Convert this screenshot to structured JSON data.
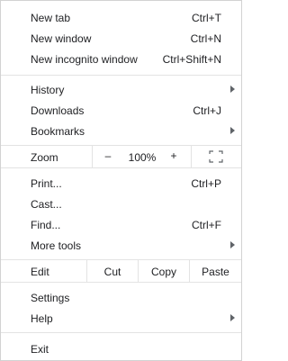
{
  "menu": {
    "items_top": [
      {
        "label": "New tab",
        "shortcut": "Ctrl+T"
      },
      {
        "label": "New window",
        "shortcut": "Ctrl+N"
      },
      {
        "label": "New incognito window",
        "shortcut": "Ctrl+Shift+N"
      }
    ],
    "history": {
      "label": "History"
    },
    "downloads": {
      "label": "Downloads",
      "shortcut": "Ctrl+J"
    },
    "bookmarks": {
      "label": "Bookmarks"
    },
    "zoom": {
      "label": "Zoom",
      "minus": "–",
      "value": "100%",
      "plus": "+"
    },
    "print": {
      "label": "Print...",
      "shortcut": "Ctrl+P"
    },
    "cast": {
      "label": "Cast..."
    },
    "find": {
      "label": "Find...",
      "shortcut": "Ctrl+F"
    },
    "more_tools": {
      "label": "More tools"
    },
    "edit": {
      "label": "Edit",
      "cut": "Cut",
      "copy": "Copy",
      "paste": "Paste"
    },
    "settings": {
      "label": "Settings"
    },
    "help": {
      "label": "Help"
    },
    "exit": {
      "label": "Exit"
    }
  },
  "colors": {
    "text": "#202124",
    "separator": "#e3e3e3",
    "border": "#d2d2d2",
    "arrow": "#5f6368"
  }
}
